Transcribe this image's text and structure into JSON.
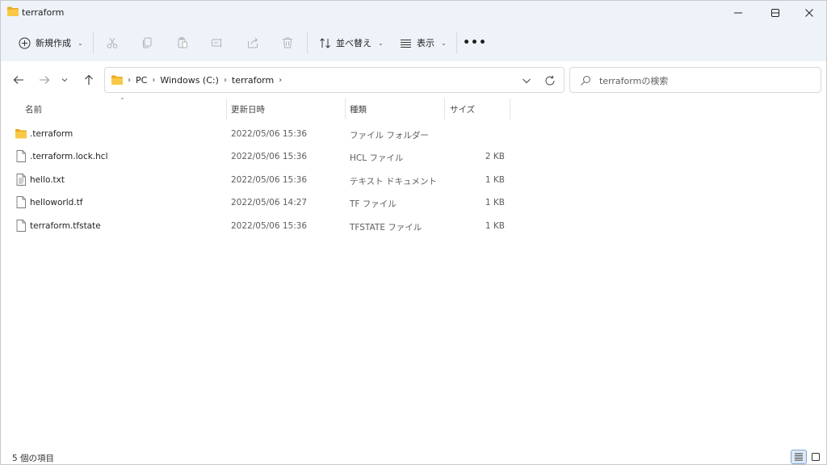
{
  "window": {
    "title": "terraform",
    "controls": {
      "minimize": "minimize",
      "maximize": "maximize",
      "close": "close"
    }
  },
  "toolbar": {
    "new_label": "新規作成",
    "sort_label": "並べ替え",
    "view_label": "表示",
    "more_label": "•••",
    "icons": [
      "cut-icon",
      "copy-icon",
      "paste-icon",
      "rename-icon",
      "share-icon",
      "delete-icon"
    ]
  },
  "address": {
    "breadcrumbs": [
      "PC",
      "Windows (C:)",
      "terraform"
    ],
    "separator": "›"
  },
  "search": {
    "placeholder": "terraformの検索"
  },
  "columns": {
    "name": "名前",
    "date": "更新日時",
    "type": "種類",
    "size": "サイズ"
  },
  "files": [
    {
      "name": ".terraform",
      "date": "2022/05/06 15:36",
      "type": "ファイル フォルダー",
      "size": "",
      "icon": "folder-icon"
    },
    {
      "name": ".terraform.lock.hcl",
      "date": "2022/05/06 15:36",
      "type": "HCL ファイル",
      "size": "2 KB",
      "icon": "file-icon"
    },
    {
      "name": "hello.txt",
      "date": "2022/05/06 15:36",
      "type": "テキスト ドキュメント",
      "size": "1 KB",
      "icon": "text-file-icon"
    },
    {
      "name": "helloworld.tf",
      "date": "2022/05/06 14:27",
      "type": "TF ファイル",
      "size": "1 KB",
      "icon": "file-icon"
    },
    {
      "name": "terraform.tfstate",
      "date": "2022/05/06 15:36",
      "type": "TFSTATE ファイル",
      "size": "1 KB",
      "icon": "file-icon"
    }
  ],
  "status": {
    "item_count": "5 個の項目"
  },
  "colors": {
    "folder": "#f8c846",
    "chrome": "#eef3f9",
    "accent": "#7ea6d3"
  }
}
